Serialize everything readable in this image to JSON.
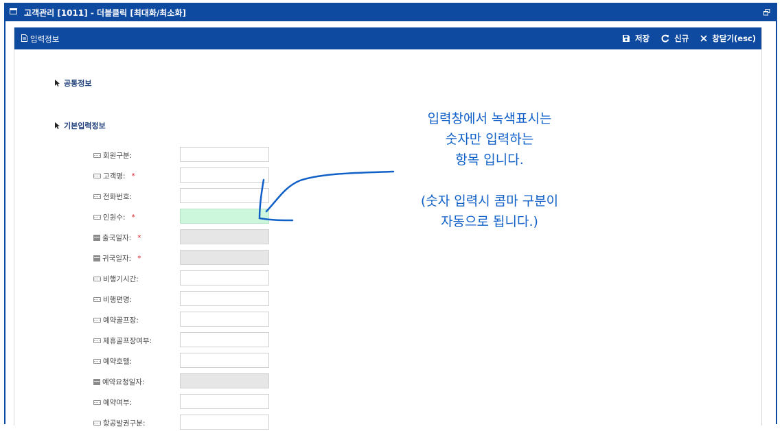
{
  "window": {
    "title": "고객관리 [1011] - 더블클릭 [최대화/최소화]"
  },
  "panel": {
    "title": "입력정보",
    "toolbar": {
      "save_label": "저장",
      "new_label": "신규",
      "close_label": "창닫기(esc)"
    }
  },
  "sections": {
    "common": "공통정보",
    "basic": "기본입력정보"
  },
  "required_mark": "*",
  "fields": [
    {
      "label": "회원구분:",
      "icon": "keyboard-icon",
      "required": false,
      "type": "text"
    },
    {
      "label": "고객명:",
      "icon": "keyboard-icon",
      "required": true,
      "type": "text"
    },
    {
      "label": "전화번호:",
      "icon": "keyboard-icon",
      "required": false,
      "type": "text"
    },
    {
      "label": "인원수:",
      "icon": "keyboard-icon",
      "required": true,
      "type": "numeric"
    },
    {
      "label": "출국일자:",
      "icon": "calendar-icon",
      "required": true,
      "type": "date"
    },
    {
      "label": "귀국일자:",
      "icon": "calendar-icon",
      "required": true,
      "type": "date"
    },
    {
      "label": "비행기시간:",
      "icon": "keyboard-icon",
      "required": false,
      "type": "text"
    },
    {
      "label": "비행편명:",
      "icon": "keyboard-icon",
      "required": false,
      "type": "text"
    },
    {
      "label": "예약골프장:",
      "icon": "keyboard-icon",
      "required": false,
      "type": "text"
    },
    {
      "label": "제휴골프장여부:",
      "icon": "keyboard-icon",
      "required": false,
      "type": "text"
    },
    {
      "label": "예약호텔:",
      "icon": "keyboard-icon",
      "required": false,
      "type": "text"
    },
    {
      "label": "예약요청일자:",
      "icon": "calendar-icon",
      "required": false,
      "type": "date"
    },
    {
      "label": "예약여부:",
      "icon": "keyboard-icon",
      "required": false,
      "type": "text"
    },
    {
      "label": "항공발권구분:",
      "icon": "keyboard-icon",
      "required": false,
      "type": "text"
    }
  ],
  "colors": {
    "header_blue": "#0e4aa0",
    "numeric_field_green": "#ccf7dc",
    "readonly_gray": "#e6e6e6",
    "required_red": "#d9262c",
    "annotation_blue": "#1060c8"
  },
  "annotation": {
    "line1": "입력창에서 녹색표시는",
    "line2": "숫자만 입력하는",
    "line3": "항목 입니다.",
    "line4": "(숫자 입력시 콤마 구분이",
    "line5": "자동으로 됩니다.)"
  }
}
